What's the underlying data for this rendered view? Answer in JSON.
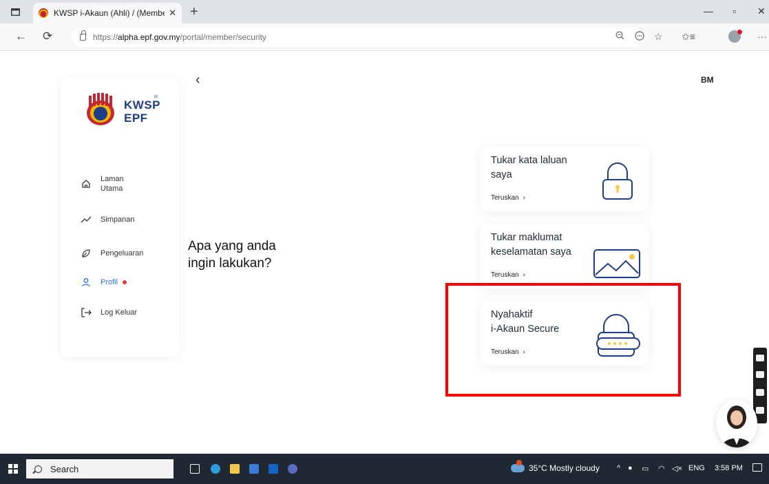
{
  "browser": {
    "tab_title": "KWSP i-Akaun (Ahli) / (Member)",
    "url_prefix": "https://",
    "url_host": "alpha.epf.gov.my",
    "url_path": "/portal/member/security"
  },
  "header": {
    "lang": "BM"
  },
  "logo": {
    "line1": "KWSP",
    "line2": "EPF",
    "mark": "®"
  },
  "sidebar": {
    "items": [
      {
        "label_line1": "Laman",
        "label_line2": "Utama",
        "icon": "home-icon"
      },
      {
        "label": "Simpanan",
        "icon": "trend-icon"
      },
      {
        "label": "Pengeluaran",
        "icon": "leaf-icon"
      },
      {
        "label": "Profil",
        "icon": "user-icon",
        "active": true
      },
      {
        "label": "Log Keluar",
        "icon": "logout-icon"
      }
    ]
  },
  "main": {
    "question_line1": "Apa yang anda",
    "question_line2": "ingin lakukan?",
    "cards": [
      {
        "title_line1": "Tukar kata laluan",
        "title_line2": "saya",
        "link": "Teruskan",
        "icon": "padlock-icon"
      },
      {
        "title_line1": "Tukar maklumat",
        "title_line2": "keselamatan saya",
        "link": "Teruskan",
        "icon": "image-icon"
      },
      {
        "title_line1": "Nyahaktif",
        "title_line2": "i-Akaun Secure",
        "link": "Teruskan",
        "icon": "secure-padlock-icon"
      }
    ]
  },
  "taskbar": {
    "search_label": "Search",
    "weather": "35°C  Mostly cloudy",
    "lang": "ENG",
    "time": "3:58 PM"
  },
  "colors": {
    "accent": "#2b6cf6",
    "brand": "#1f3c88",
    "highlight": "#ff0000",
    "lock_gold": "#f2c94c"
  }
}
